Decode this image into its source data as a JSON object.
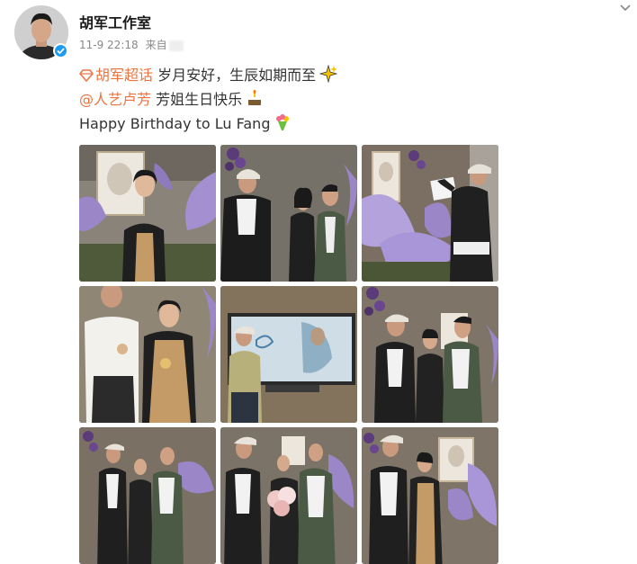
{
  "post": {
    "username": "胡军工作室",
    "timestamp": "11-9 22:18",
    "source_prefix": "来自",
    "hashtag_topic": "胡军超话",
    "line1_text": "岁月安好，生辰如期而至",
    "mention": "@人艺卢芳",
    "line2_text": "芳姐生日快乐",
    "line3_text": "Happy Birthday to Lu Fang"
  },
  "icons": {
    "verified": "verified-badge-icon",
    "hashtag": "super-topic-diamond-icon",
    "sparkle": "sparkles-emoji",
    "cake": "cake-emoji",
    "bouquet": "bouquet-emoji",
    "menu": "chevron-down-icon"
  },
  "colors": {
    "link": "#eb7340",
    "verified": "#1d9bf0",
    "flower_purple": "#9b86c8"
  },
  "photos": [
    {
      "scene": "woman-in-front-of-portrait"
    },
    {
      "scene": "man-in-cap-handing-gift"
    },
    {
      "scene": "man-hanging-portrait"
    },
    {
      "scene": "couple-with-drinks"
    },
    {
      "scene": "man-watching-screen"
    },
    {
      "scene": "group-of-three"
    },
    {
      "scene": "group-of-three"
    },
    {
      "scene": "group-with-bouquet"
    },
    {
      "scene": "group-with-portrait"
    }
  ]
}
